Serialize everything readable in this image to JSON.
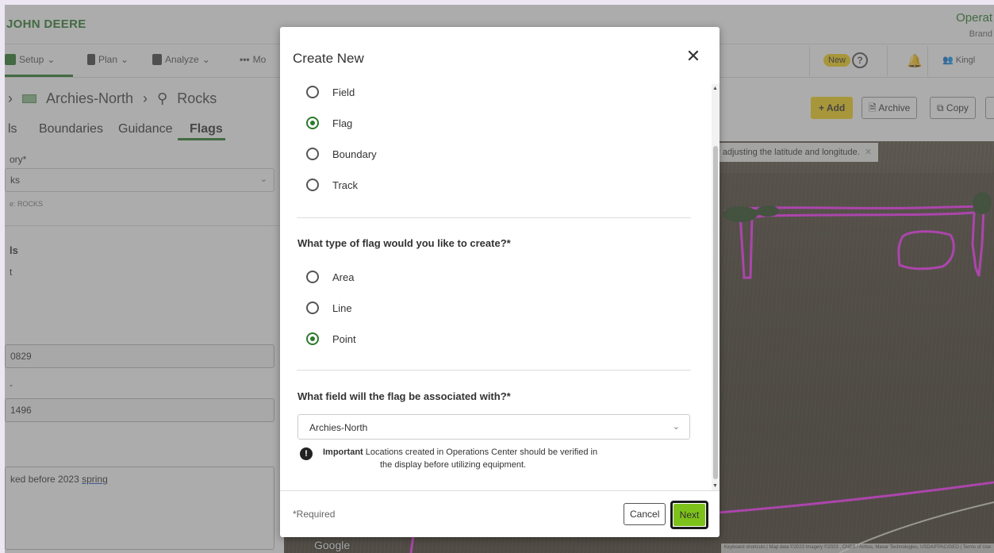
{
  "app": {
    "logo": "JOHN DEERE",
    "org_title": "Operat",
    "org_sub": "Brand"
  },
  "nav": {
    "items": [
      {
        "label": "Setup",
        "icon": "setup-icon"
      },
      {
        "label": "Plan",
        "icon": "plan-icon"
      },
      {
        "label": "Analyze",
        "icon": "analyze-icon"
      },
      {
        "label": "Mo",
        "icon": "more-icon"
      }
    ],
    "new_badge": "New",
    "help_glyph": "?",
    "user_label": "Kingl"
  },
  "breadcrumb": {
    "field": "Archies-North",
    "flag": "Rocks"
  },
  "subtabs": [
    "ls",
    "Boundaries",
    "Guidance",
    "Flags"
  ],
  "actions": {
    "add": "+ Add",
    "archive": "Archive",
    "copy": "Copy"
  },
  "left_panel": {
    "category_label": "ory*",
    "category_value": "ks",
    "category_hint": "e: ROCKS",
    "details_label": "ls",
    "details_sub": "t",
    "lat_value": "0829",
    "lon_label": "-",
    "lon_value": "1496",
    "notes_value_a": "ked before 2023 ",
    "notes_value_b": "spring"
  },
  "map": {
    "tip": "r adjusting the latitude and longitude.",
    "google": "Google",
    "attribution": "Keyboard shortcuts  |  Map data ©2023 Imagery ©2023 , CNES / Airbus, Maxar Technologies, USDA/FPAC/GEO  |  Terms of Use"
  },
  "modal": {
    "title": "Create New",
    "types": [
      {
        "label": "Field",
        "checked": false
      },
      {
        "label": "Flag",
        "checked": true
      },
      {
        "label": "Boundary",
        "checked": false
      },
      {
        "label": "Track",
        "checked": false
      }
    ],
    "flag_question": "What type of flag would you like to create?*",
    "flag_types": [
      {
        "label": "Area",
        "checked": false
      },
      {
        "label": "Line",
        "checked": false
      },
      {
        "label": "Point",
        "checked": true
      }
    ],
    "field_question": "What field will the flag be associated with?*",
    "field_value": "Archies-North",
    "important_label": "Important",
    "important_text_1": " Locations created in Operations Center should be verified in",
    "important_text_2": "the display before utilizing equipment.",
    "required_note": "*Required",
    "cancel": "Cancel",
    "next": "Next"
  }
}
